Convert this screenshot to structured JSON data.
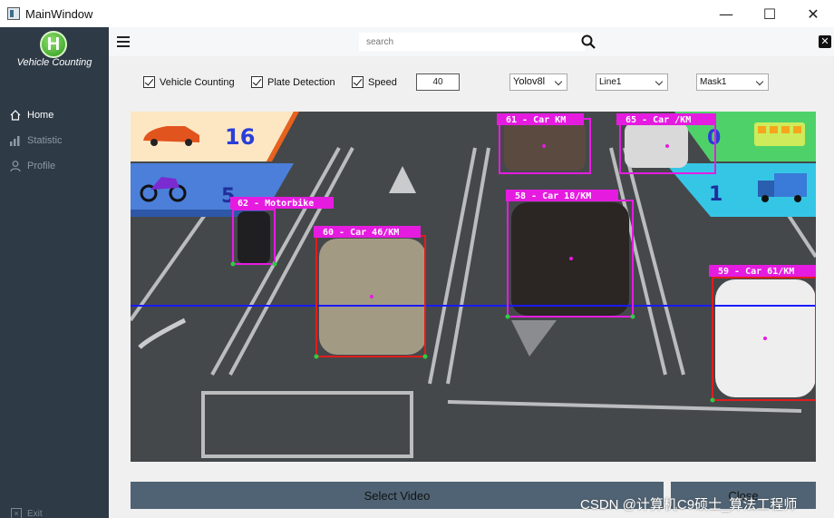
{
  "window": {
    "title": "MainWindow",
    "minimize": "—",
    "maximize": "☐",
    "close": "✕"
  },
  "sidebar": {
    "logo_letter": "H",
    "app_name": "Vehicle Counting",
    "items": [
      {
        "label": "Home",
        "icon": "home-icon",
        "active": true
      },
      {
        "label": "Statistic",
        "icon": "bar-chart-icon",
        "active": false
      },
      {
        "label": "Profile",
        "icon": "user-icon",
        "active": false
      }
    ],
    "exit_label": "Exit"
  },
  "topbar": {
    "search_placeholder": "search",
    "close_glyph": "✕"
  },
  "controls": {
    "vehicle_counting": "Vehicle Counting",
    "plate_detection": "Plate Detection",
    "speed": "Speed",
    "speed_value": "40",
    "model": "Yolov8l",
    "line": "Line1",
    "mask": "Mask1"
  },
  "video": {
    "counts": {
      "car_in": "16",
      "bike_in": "5",
      "bus_out": "0",
      "truck_out": "1"
    },
    "detections": [
      {
        "label": "61 - Car KM"
      },
      {
        "label": "65 - Car /KM"
      },
      {
        "label": "62 - Motorbike"
      },
      {
        "label": "58 - Car 18/KM"
      },
      {
        "label": "60 - Car 46/KM"
      },
      {
        "label": "59 - Car 61/KM"
      }
    ],
    "colors": {
      "panel_left_car": "#fde7c3",
      "panel_left_bike": "#4b7fd9",
      "panel_right_bus": "#4fd16a",
      "panel_right_truck": "#35c6e6",
      "count_line": "#1a1aff",
      "box_magenta": "#e51ce0",
      "box_red": "#e11c1c"
    }
  },
  "buttons": {
    "select_video": "Select Video",
    "close": "Close"
  },
  "watermark": "CSDN @计算机C9硕士_算法工程师"
}
